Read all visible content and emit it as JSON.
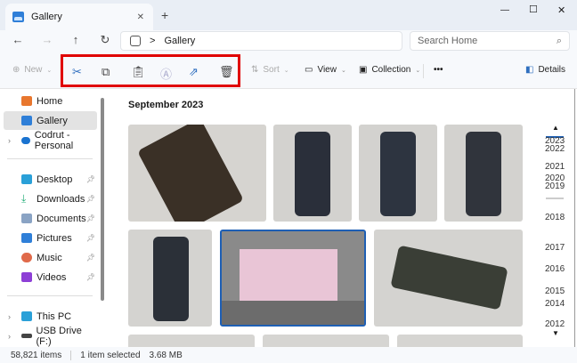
{
  "window": {
    "tab_title": "Gallery",
    "new_tab": "+",
    "close_tab": "✕",
    "minimize": "—",
    "maximize": "☐",
    "close": "✕"
  },
  "nav": {
    "back": "←",
    "forward": "→",
    "up": "↑",
    "refresh": "↻",
    "breadcrumb_sep": ">",
    "location": "Gallery",
    "search_placeholder": "Search Home"
  },
  "toolbar": {
    "new": "New",
    "cut": "Cut",
    "copy": "Copy",
    "paste": "Paste",
    "rename": "Rename",
    "share": "Share",
    "delete": "Delete",
    "sort": "Sort",
    "view": "View",
    "collection": "Collection",
    "more": "•••",
    "details": "Details"
  },
  "sidebar": {
    "items": [
      {
        "label": "Home",
        "color": "#e8772e"
      },
      {
        "label": "Gallery",
        "color": "#2f7fd8"
      },
      {
        "label": "Codrut - Personal",
        "color": "#1a73d0"
      },
      {
        "label": "Desktop",
        "color": "#2aa0d8"
      },
      {
        "label": "Downloads",
        "color": "#2bb07c"
      },
      {
        "label": "Documents",
        "color": "#8aa3c4"
      },
      {
        "label": "Pictures",
        "color": "#2f7fd8"
      },
      {
        "label": "Music",
        "color": "#e06a4a"
      },
      {
        "label": "Videos",
        "color": "#8d3fd6"
      },
      {
        "label": "This PC",
        "color": "#2aa0d8"
      },
      {
        "label": "USB Drive (F:)",
        "color": "#444444"
      }
    ]
  },
  "content": {
    "section_title": "September 2023"
  },
  "timeline": {
    "years": [
      "2023",
      "2022",
      "2021",
      "2020",
      "2019",
      "2018",
      "2017",
      "2016",
      "2015",
      "2014",
      "2012"
    ],
    "up": "▲",
    "down": "▼"
  },
  "status": {
    "items": "58,821 items",
    "selected": "1 item selected",
    "size": "3.68 MB"
  }
}
